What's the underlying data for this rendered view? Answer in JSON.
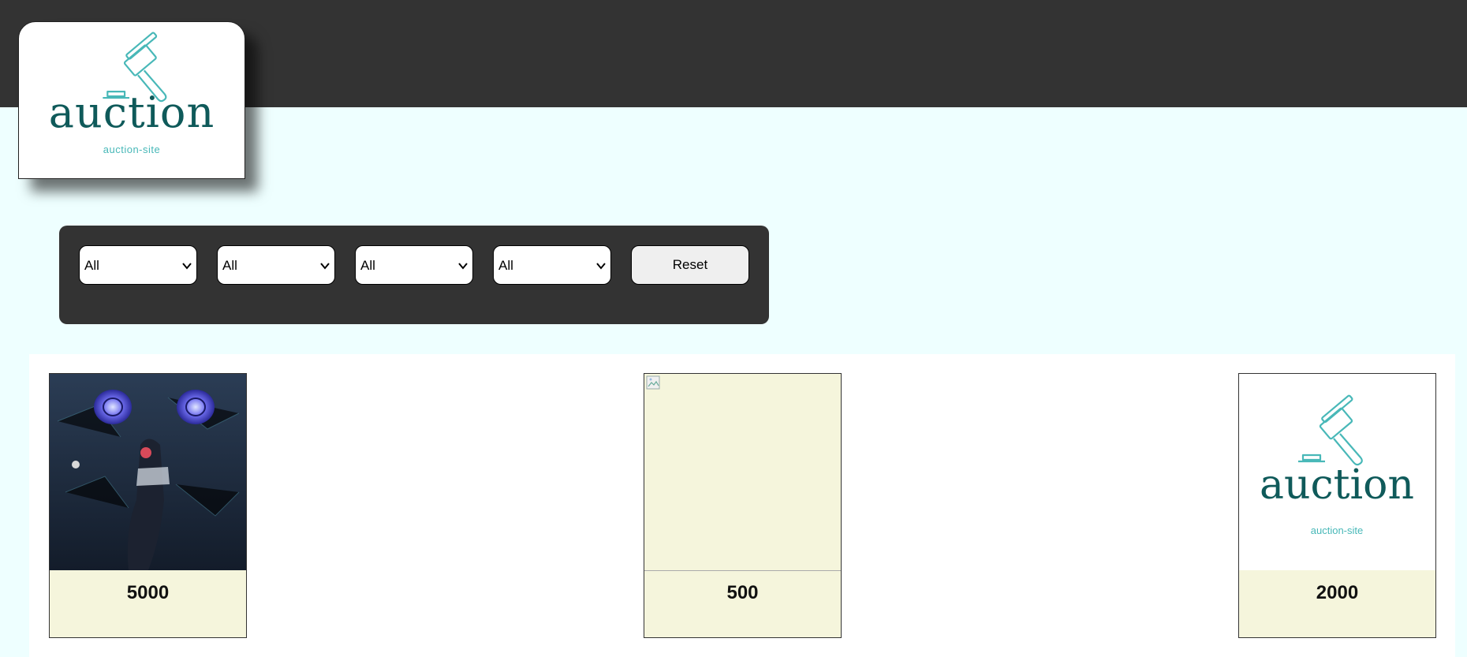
{
  "header": {
    "logo": {
      "word": "auction",
      "subtitle": "auction-site",
      "colors": {
        "word": "#0f5a5a",
        "accent": "#48b8b8"
      }
    }
  },
  "filters": {
    "selects": [
      {
        "value": "All"
      },
      {
        "value": "All"
      },
      {
        "value": "All"
      },
      {
        "value": "All"
      }
    ],
    "reset_label": "Reset"
  },
  "items": [
    {
      "price": "5000",
      "image": "artwork-figure-image"
    },
    {
      "price": "500",
      "image": "broken-image-icon"
    },
    {
      "price": "2000",
      "image": "auction-logo-image"
    }
  ],
  "colors": {
    "topbar": "#333333",
    "page_bg": "#eeffff",
    "card_caption_bg": "#f5f5dc"
  }
}
